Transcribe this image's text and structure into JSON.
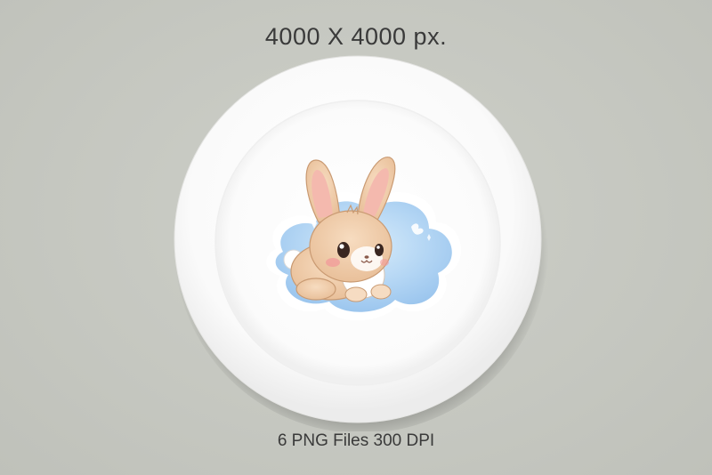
{
  "header": {
    "text": "4000 X 4000 px."
  },
  "footer": {
    "text": "6 PNG Files 300 DPI"
  },
  "artwork": {
    "subject": "bunny",
    "background_color": "#c7c9c2",
    "plate_color": "#fdfdfd",
    "cloud_color": "#a9cdf0",
    "bunny_fur_color": "#f1cfae"
  }
}
